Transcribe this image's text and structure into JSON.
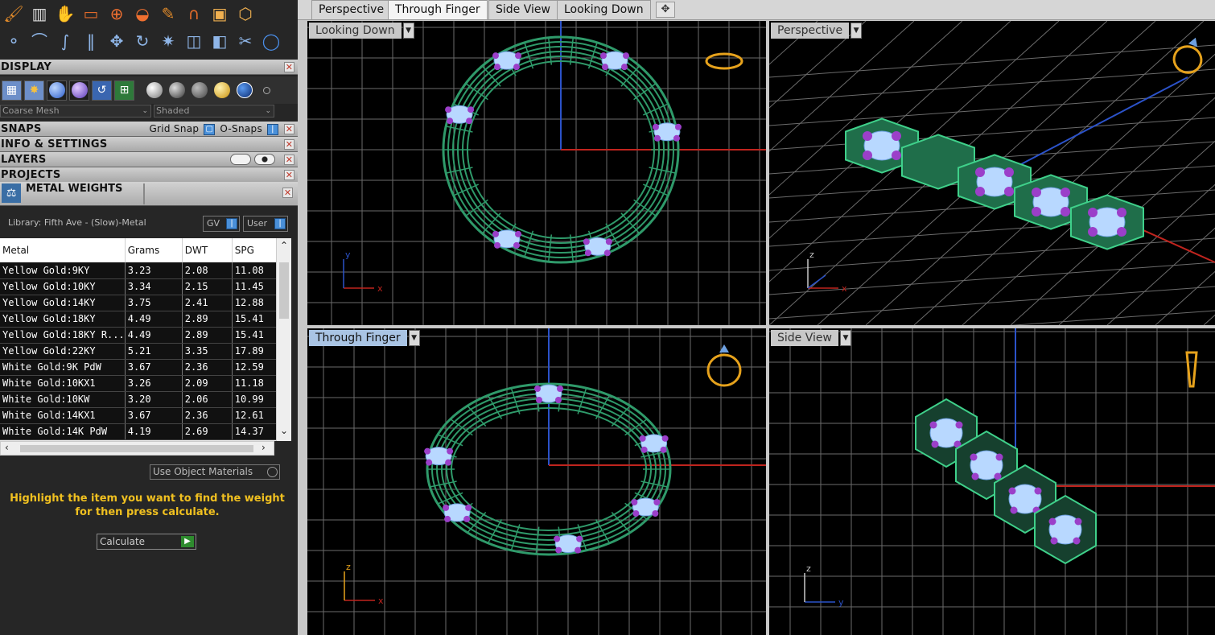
{
  "toolbar": {
    "row1": [
      "brush-icon",
      "books-icon",
      "hand-tool-icon",
      "monitor-icon",
      "target-icon",
      "bowl-icon",
      "pencil-icon",
      "magnet-icon",
      "box-icon",
      "cube-wire-icon"
    ],
    "row2": [
      "node-icon",
      "arc-icon",
      "curve-icon",
      "split-icon",
      "move-icon",
      "rotate-icon",
      "spray-icon",
      "boolean-icon",
      "mirror-icon",
      "scissors-icon",
      "circle-icon"
    ]
  },
  "display": {
    "title": "DISPLAY",
    "mesh_select": "Coarse Mesh",
    "shade_select": "Shaded"
  },
  "snaps": {
    "title": "SNAPS",
    "grid_snap": "Grid Snap",
    "osnaps": "O-Snaps"
  },
  "info": {
    "title": "INFO & SETTINGS"
  },
  "layers": {
    "title": "LAYERS"
  },
  "projects": {
    "title": "PROJECTS"
  },
  "metal_weights": {
    "title": "METAL WEIGHTS",
    "library": "Library: Fifth Ave - (Slow)-Metal",
    "gv_label": "GV",
    "user_label": "User",
    "columns": [
      "Metal",
      "Grams",
      "DWT",
      "SPG"
    ],
    "rows": [
      [
        "Yellow Gold:9KY",
        "3.23",
        "2.08",
        "11.08"
      ],
      [
        "Yellow Gold:10KY",
        "3.34",
        "2.15",
        "11.45"
      ],
      [
        "Yellow Gold:14KY",
        "3.75",
        "2.41",
        "12.88"
      ],
      [
        "Yellow Gold:18KY",
        "4.49",
        "2.89",
        "15.41"
      ],
      [
        "Yellow Gold:18KY R...",
        "4.49",
        "2.89",
        "15.41"
      ],
      [
        "Yellow Gold:22KY",
        "5.21",
        "3.35",
        "17.89"
      ],
      [
        "White Gold:9K PdW",
        "3.67",
        "2.36",
        "12.59"
      ],
      [
        "White Gold:10KX1",
        "3.26",
        "2.09",
        "11.18"
      ],
      [
        "White Gold:10KW",
        "3.20",
        "2.06",
        "10.99"
      ],
      [
        "White Gold:14KX1",
        "3.67",
        "2.36",
        "12.61"
      ],
      [
        "White Gold:14K PdW",
        "4.19",
        "2.69",
        "14.37"
      ]
    ],
    "use_object_materials": "Use Object Materials",
    "hint": "Highlight the item you want to find the weight for then press calculate.",
    "calculate": "Calculate"
  },
  "tabs": [
    "Perspective",
    "Through Finger",
    "Side View",
    "Looking Down"
  ],
  "active_tab": "Through Finger",
  "viewports": {
    "top_left": {
      "label": "Looking Down",
      "x_axis": "x",
      "y_axis": "y"
    },
    "top_right": {
      "label": "Perspective",
      "x_axis": "x",
      "y_axis": "y",
      "z_axis": "z"
    },
    "bottom_left": {
      "label": "Through Finger",
      "x_axis": "x",
      "z_axis": "z"
    },
    "bottom_right": {
      "label": "Side View",
      "y_axis": "y",
      "z_axis": "z"
    }
  },
  "colors": {
    "ring_green": "#2f9a6a",
    "stone_blue": "#b8d8ff",
    "prong_purple": "#9b3fc9",
    "grid": "#6b6b6b",
    "axis_red": "#c0241e",
    "axis_blue": "#2b52c9",
    "gold_icon": "#e6a21c"
  }
}
